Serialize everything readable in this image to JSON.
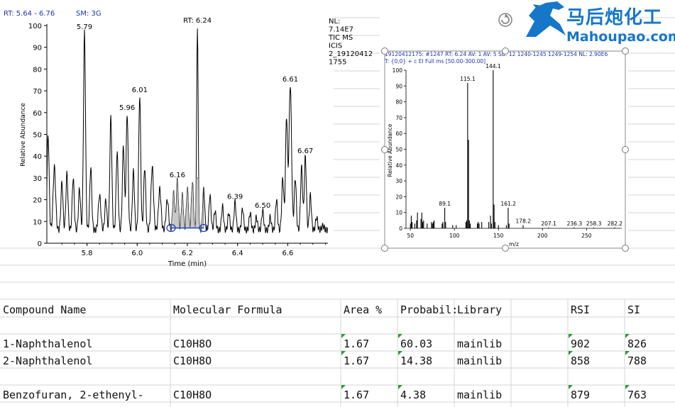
{
  "chromatogram": {
    "rt_range": "RT: 5.64 - 6.76",
    "smoothing": "SM: 3G",
    "ylabel": "Relative Abundance",
    "xlabel": "Time (min)",
    "yticks": [
      "0",
      "10",
      "20",
      "30",
      "40",
      "50",
      "60",
      "70",
      "80",
      "90",
      "100"
    ],
    "xticks": [
      "5.8",
      "6.0",
      "6.2",
      "6.4",
      "6.6"
    ],
    "info_lines": [
      "NL:",
      "7.14E7",
      "TIC MS",
      "ICIS",
      "2_19120412",
      "1755"
    ],
    "peak_labels": [
      {
        "text": "5.79",
        "rt": 5.79,
        "abundance": 97
      },
      {
        "text": "5.96",
        "rt": 5.96,
        "abundance": 60
      },
      {
        "text": "6.01",
        "rt": 6.01,
        "abundance": 68
      },
      {
        "text": "RT: 6.24",
        "rt": 6.24,
        "abundance": 100
      },
      {
        "text": "6.16",
        "rt": 6.16,
        "abundance": 29
      },
      {
        "text": "6.39",
        "rt": 6.39,
        "abundance": 19
      },
      {
        "text": "6.50",
        "rt": 6.5,
        "abundance": 15
      },
      {
        "text": "6.61",
        "rt": 6.61,
        "abundance": 73
      },
      {
        "text": "6.67",
        "rt": 6.67,
        "abundance": 40
      }
    ],
    "x_range": [
      5.64,
      6.76
    ],
    "y_range": [
      0,
      100
    ]
  },
  "spectrum": {
    "header1": "19120412175: #1247  RT: 6.24  AV: 1  AV: 5  SB: 12 1240-1245 1249-1254  NL: 2.90E6",
    "header2": "T: {0,0}  + c EI Full ms [50.00-300.00]",
    "ylabel": "Relative Abundance",
    "xlabel": "m/z",
    "yticks": [
      "0",
      "10",
      "20",
      "30",
      "40",
      "50",
      "60",
      "70",
      "80",
      "90",
      "100"
    ],
    "xticks": [
      "50",
      "100",
      "150",
      "200",
      "250"
    ],
    "x_range": [
      45,
      290
    ],
    "y_range": [
      0,
      100
    ],
    "peak_labels": [
      {
        "text": "115.1",
        "mz": 115.1,
        "abundance": 92
      },
      {
        "text": "144.1",
        "mz": 144.1,
        "abundance": 100
      },
      {
        "text": "89.1",
        "mz": 89.1,
        "abundance": 13
      },
      {
        "text": "161.2",
        "mz": 161.2,
        "abundance": 13
      },
      {
        "text": "178.2",
        "mz": 178.2,
        "abundance": 2
      },
      {
        "text": "207.1",
        "mz": 207.1,
        "abundance": 0.5
      },
      {
        "text": "236.3",
        "mz": 236.3,
        "abundance": 0.5
      },
      {
        "text": "258.3",
        "mz": 258.3,
        "abundance": 0.5
      },
      {
        "text": "282.2",
        "mz": 282.2,
        "abundance": 0.5
      }
    ]
  },
  "logo": {
    "cn": "马后炮化工",
    "en": "Mahoupao.com"
  },
  "table": {
    "headers": [
      "Compound Name",
      "Molecular Formula",
      "Area %",
      "Probabil:",
      "Library",
      "RSI",
      "SI"
    ],
    "rows": [
      [
        "1-Naphthalenol",
        "C10H8O",
        "1.67",
        "60.03",
        "mainlib",
        "902",
        "826"
      ],
      [
        "2-Naphthalenol",
        "C10H8O",
        "1.67",
        "14.38",
        "mainlib",
        "858",
        "788"
      ],
      [
        "Benzofuran, 2-ethenyl-",
        "C10H8O",
        "1.67",
        "4.38",
        "mainlib",
        "879",
        "763"
      ]
    ]
  },
  "colors": {
    "grid": "#d4d4d4",
    "accent": "#1677c9",
    "header_blue": "#2233aa",
    "flag": "#2a9a3a"
  }
}
